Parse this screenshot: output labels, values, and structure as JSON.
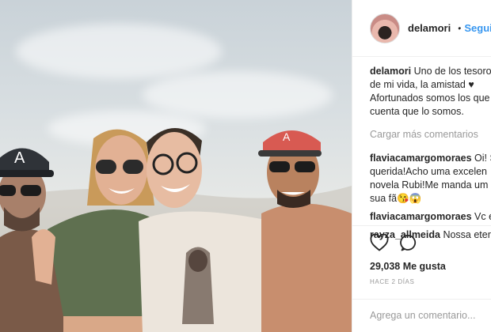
{
  "post": {
    "username": "delamori",
    "follow_label": "Seguir",
    "separator": "•",
    "caption_lines": [
      "Uno de los tesoros",
      "de mi vida, la amistad ♥",
      "Afortunados somos los que",
      "cuenta que lo somos."
    ],
    "load_more": "Cargar más comentarios",
    "comments": [
      {
        "user": "flaviacamargomoraes",
        "lines": [
          "Oi! S",
          "querida!Acho uma excelen",
          "novela Rubi!Me manda um",
          "sua fã😘😱"
        ]
      },
      {
        "user": "flaviacamargomoraes",
        "lines": [
          "Vc é"
        ]
      },
      {
        "user": "rayza_allmeida",
        "lines": [
          "Nossa etern"
        ]
      }
    ],
    "likes": "29,038 Me gusta",
    "time": "HACE 2 DÍAS",
    "add_comment_placeholder": "Agrega un comentario..."
  },
  "icons": {
    "verified": "verified-badge-icon",
    "like": "heart-icon",
    "comment": "comment-bubble-icon"
  },
  "colors": {
    "link": "#3897f0",
    "muted": "#999999",
    "text": "#262626"
  }
}
